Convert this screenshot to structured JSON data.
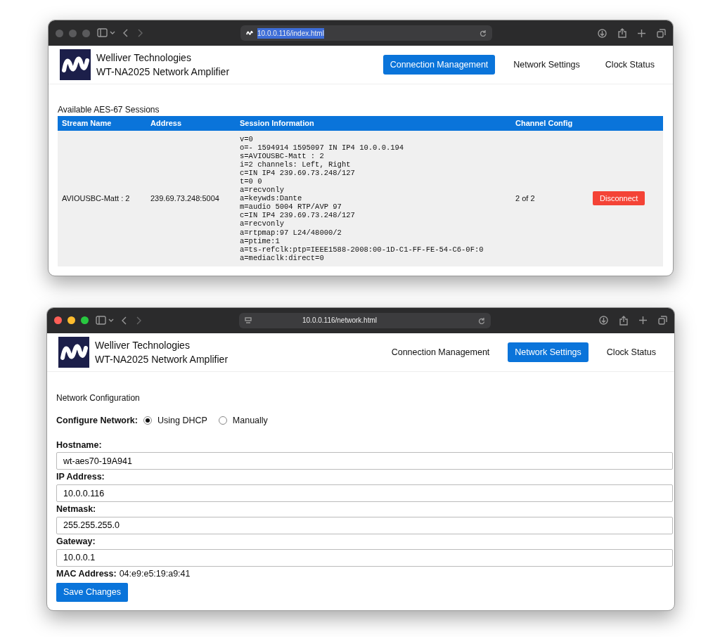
{
  "windows": [
    {
      "kind": "sessions",
      "active": false,
      "favicon": {
        "kind": "logo"
      },
      "url": "10.0.0.116/index.html",
      "url_selected": true,
      "brand": [
        "Welliver Technologies",
        "WT-NA2025 Network Amplifier"
      ],
      "nav": [
        {
          "label": "Connection Management",
          "selected": true
        },
        {
          "label": "Network Settings",
          "selected": false
        },
        {
          "label": "Clock Status",
          "selected": false
        }
      ],
      "section_title": "Available AES-67 Sessions",
      "table": {
        "columns": [
          "Stream Name",
          "Address",
          "Session Information",
          "Channel Config"
        ],
        "rows": [
          {
            "stream_name": "AVIOUSBC-Matt : 2",
            "address": "239.69.73.248:5004",
            "session_info": "v=0\no=- 1594914 1595097 IN IP4 10.0.0.194\ns=AVIOUSBC-Matt : 2\ni=2 channels: Left, Right\nc=IN IP4 239.69.73.248/127\nt=0 0\na=recvonly\na=keywds:Dante\nm=audio 5004 RTP/AVP 97\nc=IN IP4 239.69.73.248/127\na=recvonly\na=rtpmap:97 L24/48000/2\na=ptime:1\na=ts-refclk:ptp=IEEE1588-2008:00-1D-C1-FF-FE-54-C6-0F:0\na=mediaclk:direct=0",
            "channel_config": "2 of 2",
            "action": "Disconnect"
          }
        ]
      }
    },
    {
      "kind": "network",
      "active": true,
      "favicon": {
        "kind": "page"
      },
      "url": "10.0.0.116/network.html",
      "url_selected": false,
      "brand": [
        "Welliver Technologies",
        "WT-NA2025 Network Amplifier"
      ],
      "nav": [
        {
          "label": "Connection Management",
          "selected": false
        },
        {
          "label": "Network Settings",
          "selected": true
        },
        {
          "label": "Clock Status",
          "selected": false
        }
      ],
      "section_title": "Network Configuration",
      "configure_label": "Configure Network:",
      "options": [
        {
          "label": "Using DHCP",
          "selected": true
        },
        {
          "label": "Manually",
          "selected": false
        }
      ],
      "fields": [
        {
          "label": "Hostname:",
          "value": "wt-aes70-19A941"
        },
        {
          "label": "IP Address:",
          "value": "10.0.0.116"
        },
        {
          "label": "Netmask:",
          "value": "255.255.255.0"
        },
        {
          "label": "Gateway:",
          "value": "10.0.0.1"
        }
      ],
      "mac_label": "MAC Address:",
      "mac_value": "04:e9:e5:19:a9:41",
      "save_button": "Save Changes"
    }
  ]
}
